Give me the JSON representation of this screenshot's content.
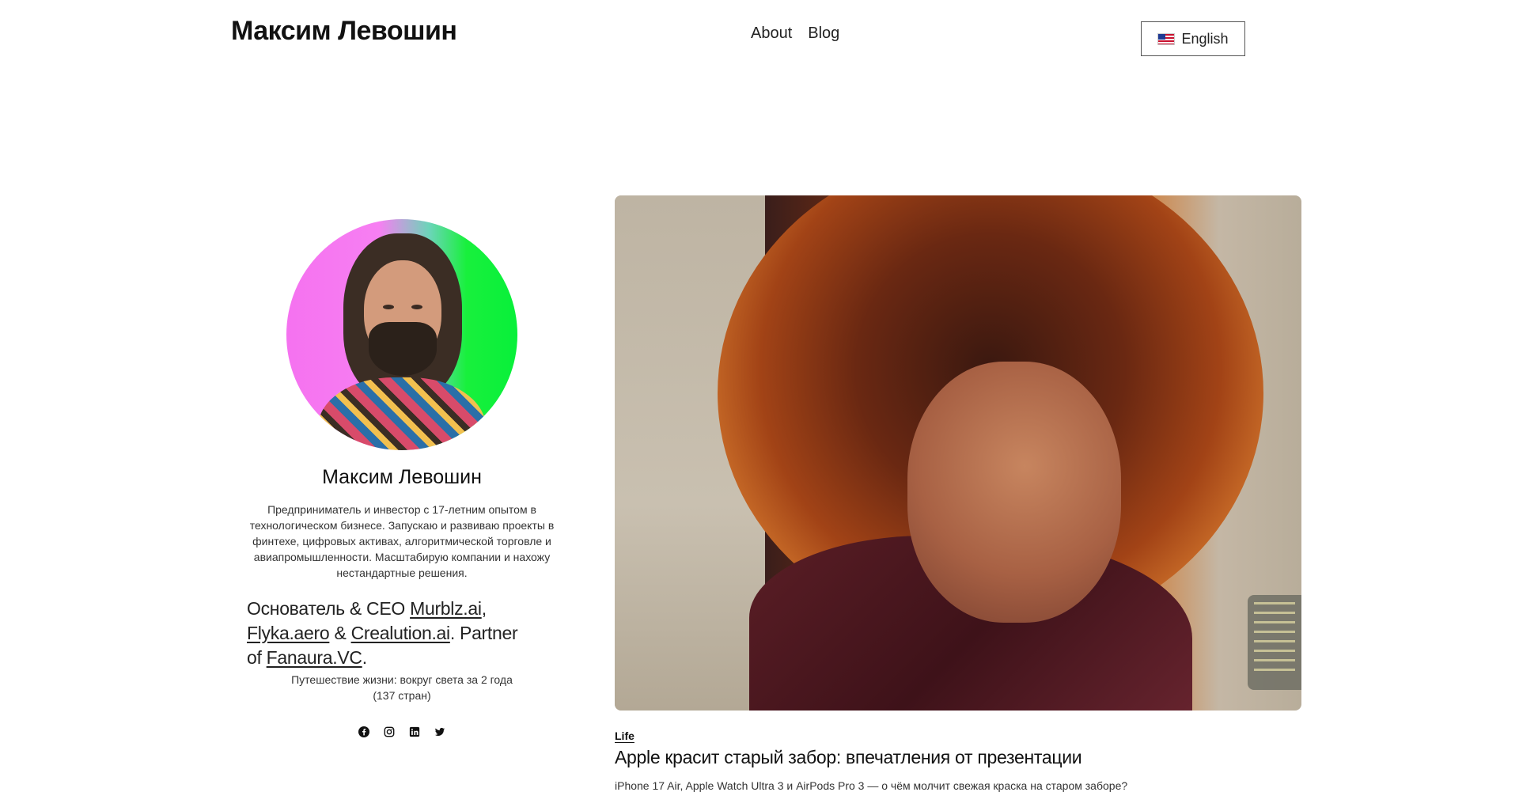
{
  "header": {
    "site_title": "Максим Левошин",
    "nav": [
      {
        "label": "About"
      },
      {
        "label": "Blog"
      }
    ],
    "language_button": {
      "label": "English",
      "flag_icon": "us-flag-icon"
    }
  },
  "profile": {
    "name": "Максим Левошин",
    "bio": "Предприниматель и инвестор с 17-летним опытом в технологическом бизнесе. Запускаю и развиваю проекты в финтехе, цифровых активах, алгоритмической торговле и авиапромышленности. Масштабирую компании и нахожу нестандартные решения.",
    "roles": {
      "prefix": "Основатель & CEO ",
      "link1": "Murblz.ai",
      "sep1": ", ",
      "link2": "Flyka.aero",
      "sep2": " & ",
      "link3": "Crealution.ai",
      "sep3": ". Partner of ",
      "link4": "Fanaura.VC",
      "suffix": "."
    },
    "travel": "Путешествие жизни: вокруг света за 2 года (137 стран)",
    "socials": [
      "facebook-icon",
      "instagram-icon",
      "linkedin-icon",
      "twitter-icon"
    ]
  },
  "post": {
    "category": "Life",
    "title": "Apple красит старый забор: впечатления от презентации",
    "excerpt": "iPhone 17 Air, Apple Watch Ultra 3 и AirPods Pro 3 — о чём молчит свежая краска на старом заборе?"
  }
}
